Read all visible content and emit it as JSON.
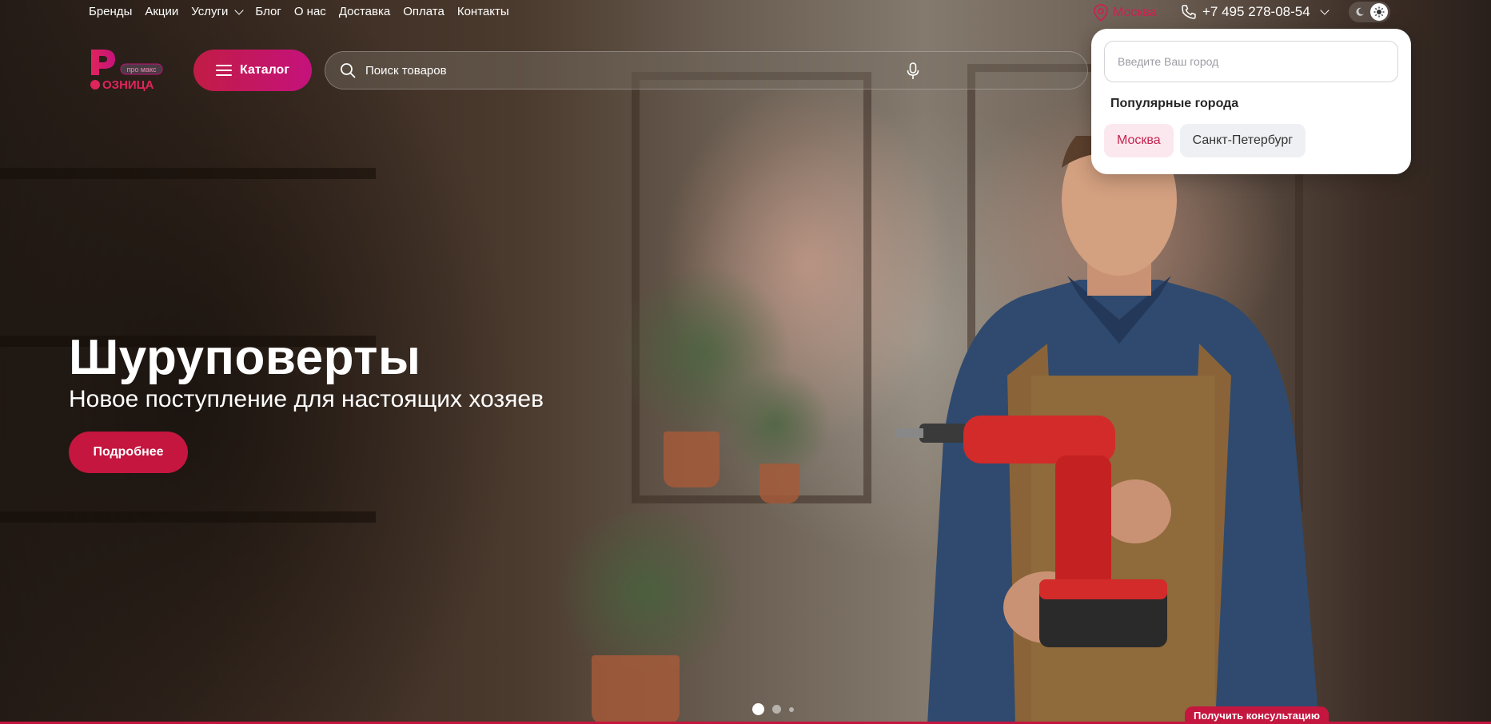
{
  "nav": {
    "items": [
      {
        "label": "Бренды"
      },
      {
        "label": "Акции"
      },
      {
        "label": "Услуги",
        "has_dropdown": true
      },
      {
        "label": "Блог"
      },
      {
        "label": "О нас"
      },
      {
        "label": "Доставка"
      },
      {
        "label": "Оплата"
      },
      {
        "label": "Контакты"
      }
    ]
  },
  "location": {
    "city": "Москва",
    "icon": "map-pin-icon"
  },
  "contact": {
    "phone": "+7 495 278-08-54",
    "icon": "phone-icon"
  },
  "theme": {
    "modes": [
      "dark",
      "light"
    ],
    "selected": "light"
  },
  "logo": {
    "badge": "про макс",
    "name": "ОЗНИЦА",
    "letter": "Р"
  },
  "catalog": {
    "label": "Каталог"
  },
  "search": {
    "placeholder": "Поиск товаров"
  },
  "city_popup": {
    "input_placeholder": "Введите Ваш город",
    "popular_title": "Популярные города",
    "cities": [
      {
        "name": "Москва",
        "selected": true
      },
      {
        "name": "Санкт-Петербург",
        "selected": false
      }
    ]
  },
  "hero": {
    "title": "Шуруповерты",
    "subtitle": "Новое поступление для настоящих хозяев",
    "button_label": "Подробнее"
  },
  "slider": {
    "count": 3,
    "active": 1
  },
  "consult": {
    "label": "Получить консультацию"
  },
  "colors": {
    "accent": "#c4163f",
    "accent_pink": "#c5127c",
    "chip_active_bg": "#fbe8ee"
  }
}
